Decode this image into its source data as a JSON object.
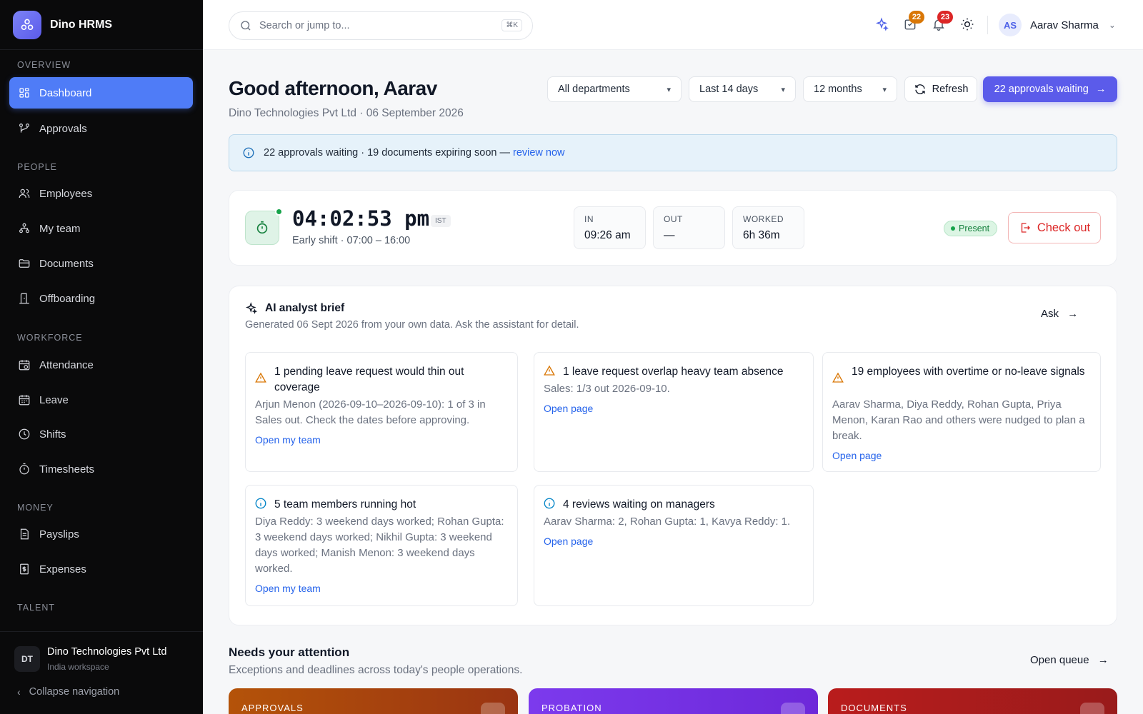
{
  "app": {
    "name": "Dino HRMS",
    "accent": "#4f7cf7",
    "primary": "#5b5bea"
  },
  "sidebar": {
    "sections": [
      {
        "label": "OVERVIEW"
      },
      {
        "label": "PEOPLE"
      },
      {
        "label": "WORKFORCE"
      },
      {
        "label": "MONEY"
      },
      {
        "label": "TALENT"
      }
    ],
    "items": [
      {
        "label": "Dashboard",
        "icon": "dashboard-icon",
        "active": true
      },
      {
        "label": "Approvals",
        "icon": "approvals-icon"
      },
      {
        "label": "Employees",
        "icon": "employees-icon"
      },
      {
        "label": "My team",
        "icon": "team-icon"
      },
      {
        "label": "Documents",
        "icon": "folder-icon"
      },
      {
        "label": "Offboarding",
        "icon": "offboarding-icon"
      },
      {
        "label": "Attendance",
        "icon": "attendance-icon"
      },
      {
        "label": "Leave",
        "icon": "calendar-icon"
      },
      {
        "label": "Shifts",
        "icon": "clock-icon"
      },
      {
        "label": "Timesheets",
        "icon": "timer-icon"
      },
      {
        "label": "Payslips",
        "icon": "payslip-icon"
      },
      {
        "label": "Expenses",
        "icon": "expenses-icon"
      }
    ],
    "footer": {
      "org_initials": "DT",
      "org_name": "Dino Technologies Pvt Ltd",
      "org_sub": "India workspace",
      "collapse_label": "Collapse navigation"
    }
  },
  "topbar": {
    "search_placeholder": "Search or jump to...",
    "search_shortcut": "⌘K",
    "tasks_badge": "22",
    "notifications_badge": "23",
    "user_initials": "AS",
    "user_name": "Aarav Sharma"
  },
  "header": {
    "greeting": "Good afternoon, Aarav",
    "subline": "Dino Technologies Pvt Ltd · 06 September 2026",
    "filters": {
      "department": "All departments",
      "range": "Last 14 days",
      "period": "12 months"
    },
    "refresh_label": "Refresh",
    "approvals_button": "22 approvals waiting"
  },
  "banner": {
    "text": "22 approvals waiting · 19 documents expiring soon —",
    "link": "review now"
  },
  "clock": {
    "time": "04:02:53 pm",
    "tz": "IST",
    "shift": "Early shift · 07:00 – 16:00",
    "in_label": "IN",
    "in_value": "09:26 am",
    "out_label": "OUT",
    "out_value": "—",
    "worked_label": "WORKED",
    "worked_value": "6h 36m",
    "status": "Present",
    "checkout_label": "Check out"
  },
  "ai_brief": {
    "title": "AI analyst brief",
    "subtitle": "Generated 06 Sept 2026 from your own data. Ask the assistant for detail.",
    "ask_label": "Ask",
    "insights": [
      {
        "kind": "warning",
        "title": "1 pending leave request would thin out coverage",
        "body": "Arjun Menon (2026-09-10–2026-09-10): 1 of 3 in Sales out. Check the dates before approving.",
        "link": "Open my team"
      },
      {
        "kind": "warning",
        "title": "1 leave request overlap heavy team absence",
        "body": "Sales: 1/3 out 2026-09-10.",
        "link": "Open page"
      },
      {
        "kind": "warning",
        "title": "19 employees with overtime or no-leave signals",
        "body": "Aarav Sharma, Diya Reddy, Rohan Gupta, Priya Menon, Karan Rao and others were nudged to plan a break.",
        "link": "Open page"
      },
      {
        "kind": "info",
        "title": "5 team members running hot",
        "body": "Diya Reddy: 3 weekend days worked; Rohan Gupta: 3 weekend days worked; Nikhil Gupta: 3 weekend days worked; Manish Menon: 3 weekend days worked.",
        "link": "Open my team"
      },
      {
        "kind": "info",
        "title": "4 reviews waiting on managers",
        "body": "Aarav Sharma: 2, Rohan Gupta: 1, Kavya Reddy: 1.",
        "link": "Open page"
      }
    ]
  },
  "attention": {
    "title": "Needs your attention",
    "subtitle": "Exceptions and deadlines across today's people operations.",
    "open_queue": "Open queue",
    "tiles": [
      {
        "label": "APPROVALS",
        "color": "#b45309"
      },
      {
        "label": "PROBATION",
        "color": "#7c3aed"
      },
      {
        "label": "DOCUMENTS",
        "color": "#b91c1c"
      }
    ]
  }
}
